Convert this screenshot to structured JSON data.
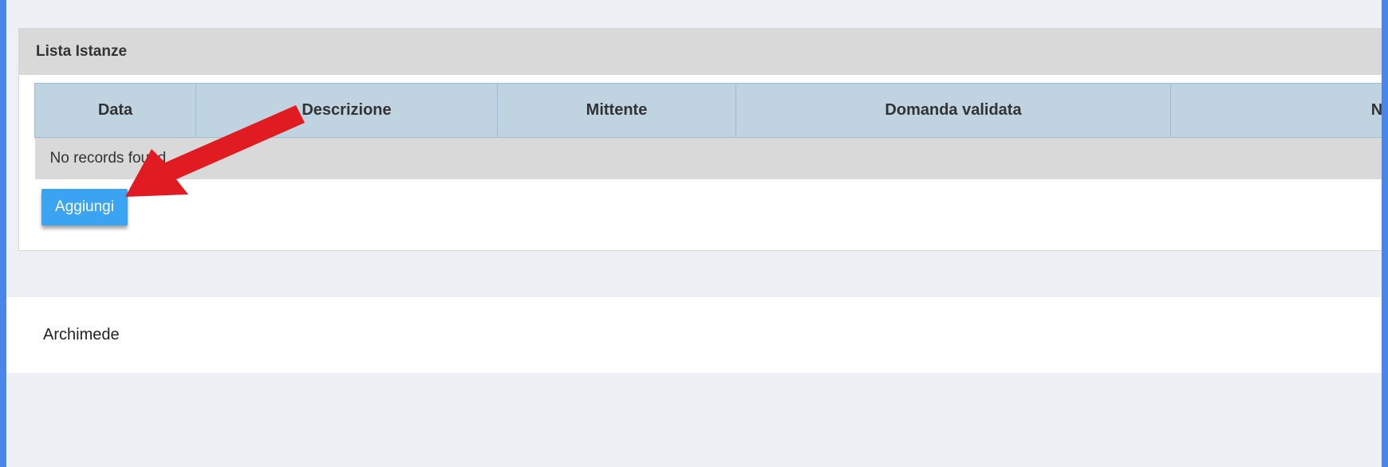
{
  "panel": {
    "title": "Lista Istanze",
    "columns": [
      "Data",
      "Descrizione",
      "Mittente",
      "Domanda validata",
      "Note d"
    ],
    "empty_message": "No records found",
    "add_label": "Aggiungi"
  },
  "footer": {
    "text": "Archimede"
  },
  "colors": {
    "outer_border": "#4a86e8",
    "header_bg": "#d9d9d9",
    "table_header_bg": "#bfd4e0",
    "button_bg": "#3aa4f3",
    "arrow": "#e01b22"
  },
  "annotation": {
    "icon": "red-arrow-icon"
  }
}
